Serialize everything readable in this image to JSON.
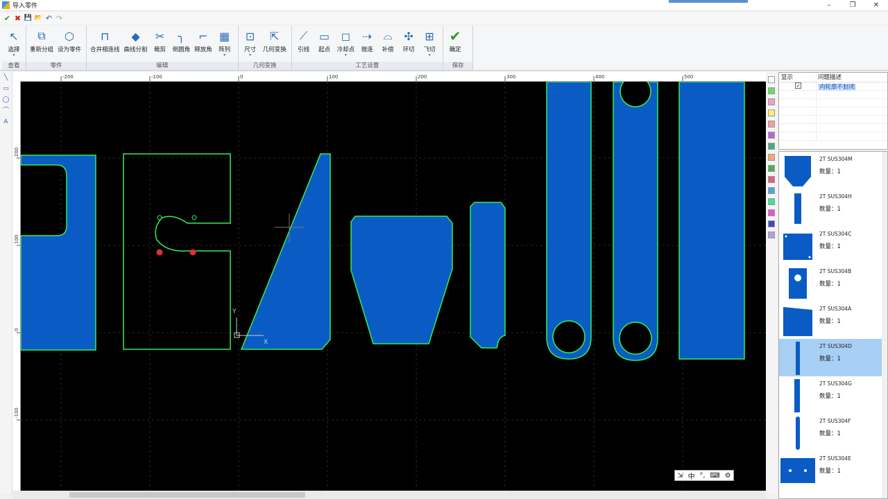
{
  "window": {
    "title": "导入零件",
    "minimize": "–",
    "restore": "❐",
    "close": "✕"
  },
  "qat": [
    "✔",
    "✖",
    "💾",
    "📂",
    "↶",
    "↷"
  ],
  "ribbon": {
    "groups": [
      {
        "label": "查看",
        "buttons": [
          {
            "label": "选择",
            "icon": "↖",
            "dd": "▾"
          }
        ]
      },
      {
        "label": "零件",
        "buttons": [
          {
            "label": "重新分组",
            "icon": "⧉",
            "dd": ""
          },
          {
            "label": "设为零件",
            "icon": "⬡",
            "dd": ""
          }
        ]
      },
      {
        "label": "编辑",
        "buttons": [
          {
            "label": "合并相连线",
            "icon": "⊓",
            "dd": ""
          },
          {
            "label": "曲线分割",
            "icon": "◆",
            "dd": ""
          },
          {
            "label": "裁剪",
            "icon": "✂",
            "dd": ""
          },
          {
            "label": "倒圆角",
            "icon": "╮",
            "dd": ""
          },
          {
            "label": "释放角",
            "icon": "⌐",
            "dd": ""
          },
          {
            "label": "阵列",
            "icon": "▦",
            "dd": "▾"
          }
        ]
      },
      {
        "label": "几何变换",
        "buttons": [
          {
            "label": "尺寸",
            "icon": "⊡",
            "dd": "▾"
          },
          {
            "label": "几何变换",
            "icon": "⇱",
            "dd": ""
          }
        ]
      },
      {
        "label": "工艺设置",
        "buttons": [
          {
            "label": "引线",
            "icon": "⟋",
            "dd": ""
          },
          {
            "label": "起点",
            "icon": "▭",
            "dd": ""
          },
          {
            "label": "冷却点",
            "icon": "◻",
            "dd": "▾"
          },
          {
            "label": "微连",
            "icon": "⇢",
            "dd": ""
          },
          {
            "label": "补偿",
            "icon": "⌓",
            "dd": ""
          },
          {
            "label": "环切",
            "icon": "✣",
            "dd": ""
          },
          {
            "label": "飞切",
            "icon": "⊞",
            "dd": "▾"
          }
        ]
      },
      {
        "label": "保存",
        "buttons": [
          {
            "label": "确定",
            "icon": "✔",
            "dd": ""
          }
        ]
      }
    ]
  },
  "lefttools": [
    "╲",
    "▭",
    "◯",
    "⌒",
    "A"
  ],
  "ruler": {
    "h": [
      "-200",
      "-100",
      "0",
      "100",
      "200",
      "300",
      "400",
      "500"
    ],
    "v": [
      "200",
      "100",
      "0",
      "-100"
    ]
  },
  "axes": {
    "x": "X",
    "y": "Y"
  },
  "swatches": [
    "#ffffff",
    "#66dd66",
    "#f0a0c8",
    "#ffee77",
    "#f0a0a0",
    "#b06ad8",
    "#44aa88",
    "#f0a878",
    "#55aa55",
    "#e06080",
    "#5aa0e0",
    "#44dd99",
    "#e855c8",
    "#4444cc",
    "#b0a0e0"
  ],
  "issues": {
    "col1": "显示",
    "col2": "问题描述",
    "rows": [
      {
        "desc": "内轮廓不封闭",
        "checked": "✓"
      }
    ]
  },
  "parts": [
    {
      "name": "2T SUS304M",
      "qty": "数量：1",
      "selected": false
    },
    {
      "name": "2T SUS304H",
      "qty": "数量：1",
      "selected": false
    },
    {
      "name": "2T SUS304C",
      "qty": "数量：1",
      "selected": false
    },
    {
      "name": "2T SUS304B",
      "qty": "数量：1",
      "selected": false
    },
    {
      "name": "2T SUS304A",
      "qty": "数量：1",
      "selected": false
    },
    {
      "name": "2T SUS304D",
      "qty": "数量：1",
      "selected": true
    },
    {
      "name": "2T SUS304G",
      "qty": "数量：1",
      "selected": false
    },
    {
      "name": "2T SUS304F",
      "qty": "数量：1",
      "selected": false
    },
    {
      "name": "2T SUS304E",
      "qty": "数量：1",
      "selected": false
    }
  ],
  "toolbox": [
    "⇲",
    "中",
    "°,",
    "⌨",
    "⚙"
  ],
  "colors": {
    "part_fill": "#0a5cc4",
    "contour": "#33ee55",
    "canvas": "#000000"
  }
}
